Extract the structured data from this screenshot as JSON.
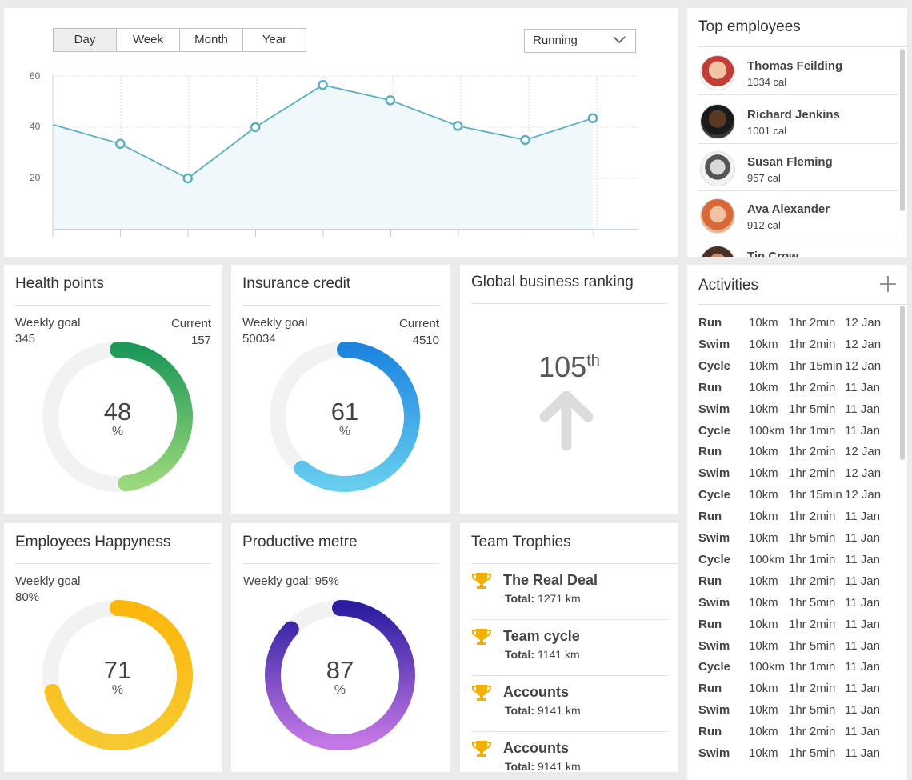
{
  "chart_panel": {
    "ranges": [
      "Day",
      "Week",
      "Month",
      "Year"
    ],
    "selected_range": "Day",
    "activity_select": "Running"
  },
  "chart_data": {
    "type": "area",
    "y_ticks": [
      "60",
      "40",
      "20"
    ],
    "ylim": [
      0,
      60
    ],
    "points": [
      41,
      33.5,
      20,
      40,
      56.5,
      50.5,
      40.5,
      35,
      43.5
    ],
    "color": "#5aafc6",
    "fill": "#f1f8fb",
    "grid": true
  },
  "top_employees": {
    "title": "Top employees",
    "items": [
      {
        "name": "Thomas Feilding",
        "cal": "1034 cal"
      },
      {
        "name": "Richard Jenkins",
        "cal": "1001 cal"
      },
      {
        "name": "Susan Fleming",
        "cal": "957 cal"
      },
      {
        "name": "Ava Alexander",
        "cal": "912 cal"
      },
      {
        "name": "Tin Crow",
        "cal": ""
      }
    ]
  },
  "health": {
    "title": "Health points",
    "goal_label": "Weekly goal",
    "goal": "345",
    "current_label": "Current",
    "current": "157",
    "percent": "48",
    "unit": "%",
    "fraction": 0.48,
    "colors": [
      "#1e9858",
      "#9ad87b"
    ]
  },
  "insurance": {
    "title": "Insurance credit",
    "goal_label": "Weekly goal",
    "goal": "50034",
    "current_label": "Current",
    "current": "4510",
    "percent": "61",
    "unit": "%",
    "fraction": 0.61,
    "colors": [
      "#1d85df",
      "#66cdee"
    ]
  },
  "ranking": {
    "title": "Global business ranking",
    "value": "105",
    "suffix": "th"
  },
  "happiness": {
    "title": "Employees Happyness",
    "goal_label": "Weekly goal",
    "goal": "80%",
    "percent": "71",
    "unit": "%",
    "fraction": 0.71,
    "colors": [
      "#fcb70d",
      "#f7c930"
    ]
  },
  "productive": {
    "title": "Productive metre",
    "goal_label": "Weekly goal: 95%",
    "percent": "87",
    "unit": "%",
    "fraction": 0.87,
    "colors": [
      "#2c1da0",
      "#c478e5"
    ]
  },
  "trophies": {
    "title": "Team Trophies",
    "total_label": "Total:",
    "items": [
      {
        "name": "The Real Deal",
        "total": "1271 km"
      },
      {
        "name": "Team cycle",
        "total": "1141 km"
      },
      {
        "name": "Accounts",
        "total": "9141 km"
      },
      {
        "name": "Accounts",
        "total": "9141 km"
      }
    ]
  },
  "activities": {
    "title": "Activities",
    "rows": [
      [
        "Run",
        "10km",
        "1hr 2min",
        "12 Jan"
      ],
      [
        "Swim",
        "10km",
        "1hr 2min",
        "12 Jan"
      ],
      [
        "Cycle",
        "10km",
        "1hr 15min",
        "12 Jan"
      ],
      [
        "Run",
        "10km",
        "1hr 2min",
        "11 Jan"
      ],
      [
        "Swim",
        "10km",
        "1hr 5min",
        "11 Jan"
      ],
      [
        "Cycle",
        "100km",
        "1hr 1min",
        "11 Jan"
      ],
      [
        "Run",
        "10km",
        "1hr 2min",
        "12 Jan"
      ],
      [
        "Swim",
        "10km",
        "1hr 2min",
        "12 Jan"
      ],
      [
        "Cycle",
        "10km",
        "1hr 15min",
        "12 Jan"
      ],
      [
        "Run",
        "10km",
        "1hr 2min",
        "11 Jan"
      ],
      [
        "Swim",
        "10km",
        "1hr 5min",
        "11 Jan"
      ],
      [
        "Cycle",
        "100km",
        "1hr 1min",
        "11 Jan"
      ],
      [
        "Run",
        "10km",
        "1hr 2min",
        "11 Jan"
      ],
      [
        "Swim",
        "10km",
        "1hr 5min",
        "11 Jan"
      ],
      [
        "Run",
        "10km",
        "1hr 2min",
        "11 Jan"
      ],
      [
        "Swim",
        "10km",
        "1hr 5min",
        "11 Jan"
      ],
      [
        "Cycle",
        "100km",
        "1hr 1min",
        "11 Jan"
      ],
      [
        "Run",
        "10km",
        "1hr 2min",
        "11 Jan"
      ],
      [
        "Swim",
        "10km",
        "1hr 5min",
        "11 Jan"
      ],
      [
        "Run",
        "10km",
        "1hr 2min",
        "11 Jan"
      ],
      [
        "Swim",
        "10km",
        "1hr 5min",
        "11 Jan"
      ]
    ]
  }
}
